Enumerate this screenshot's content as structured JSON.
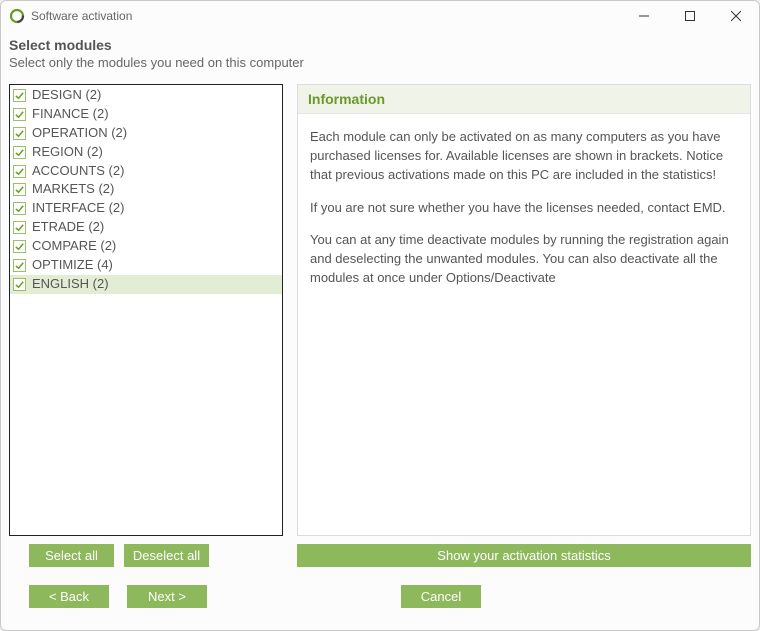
{
  "window": {
    "title": "Software activation"
  },
  "header": {
    "title": "Select modules",
    "subtitle": "Select only the modules you need on this computer"
  },
  "modules": [
    {
      "label": "DESIGN (2)",
      "checked": true,
      "selected": false
    },
    {
      "label": "FINANCE (2)",
      "checked": true,
      "selected": false
    },
    {
      "label": "OPERATION (2)",
      "checked": true,
      "selected": false
    },
    {
      "label": "REGION (2)",
      "checked": true,
      "selected": false
    },
    {
      "label": "ACCOUNTS (2)",
      "checked": true,
      "selected": false
    },
    {
      "label": "MARKETS (2)",
      "checked": true,
      "selected": false
    },
    {
      "label": "INTERFACE (2)",
      "checked": true,
      "selected": false
    },
    {
      "label": "ETRADE (2)",
      "checked": true,
      "selected": false
    },
    {
      "label": "COMPARE (2)",
      "checked": true,
      "selected": false
    },
    {
      "label": "OPTIMIZE (4)",
      "checked": true,
      "selected": false
    },
    {
      "label": "ENGLISH (2)",
      "checked": true,
      "selected": true
    }
  ],
  "buttons": {
    "select_all": "Select all",
    "deselect_all": "Deselect all",
    "show_stats": "Show your activation statistics",
    "back": "< Back",
    "next": "Next >",
    "cancel": "Cancel"
  },
  "info": {
    "heading": "Information",
    "p1": "Each module can only be activated on as many computers as you have purchased licenses for.  Available licenses are shown in brackets. Notice that previous activations made on this PC are included in the statistics!",
    "p2": "If you are not sure whether you have the licenses needed, contact EMD.",
    "p3": "You can at any time deactivate modules by running the registration again and deselecting the unwanted modules. You can also deactivate all the modules at once under Options/Deactivate"
  }
}
